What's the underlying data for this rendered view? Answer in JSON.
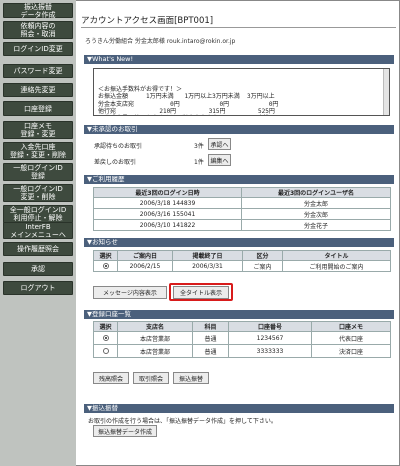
{
  "sidebar": {
    "items": [
      {
        "lines": [
          "振込振替",
          "データ作成"
        ]
      },
      {
        "lines": [
          "依頼内容の",
          "照会・取消"
        ]
      },
      {
        "lines": [
          "ログインID変更"
        ]
      },
      {
        "lines": [
          "パスワード変更"
        ]
      },
      {
        "lines": [
          "連絡先変更"
        ]
      },
      {
        "lines": [
          "口座登録"
        ]
      },
      {
        "lines": [
          "口座メモ",
          "登録・変更"
        ]
      },
      {
        "lines": [
          "入金先口座",
          "登録・変更・削除"
        ]
      },
      {
        "lines": [
          "一般ログインID",
          "登録"
        ]
      },
      {
        "lines": [
          "一般ログインID",
          "変更・削除"
        ]
      },
      {
        "lines": [
          "全一般ログインID",
          "利用停止・解除"
        ]
      },
      {
        "lines": [
          "InterFB",
          "メインメニューへ"
        ]
      },
      {
        "lines": [
          "操作履歴照会"
        ]
      },
      {
        "lines": [
          "承認"
        ]
      },
      {
        "lines": [
          "ログアウト"
        ]
      }
    ]
  },
  "header": {
    "title": "アカウントアクセス画面[BPT001]",
    "user_line": "ろうきん労働組合  労金太郎様  rouk.intaro@rokin.or.jp"
  },
  "whats_new": {
    "heading": "▼What's New!",
    "text": "＜お振込手数料がお得です！＞\nお振込金額     1万円未満   1万円以上3万円未満  3万円以上\n労金本支店宛          0円           0円           0円\n他行宛            210円         315円         525円\n※当式会員以外のお客さまは、労金本支店宛について3万円未満\n105円、3万円以上 210円です。"
  },
  "unapproved": {
    "heading": "▼未承認のお取引",
    "rows": [
      {
        "label": "承認待ちのお取引",
        "count": "3件",
        "button": "承認へ"
      },
      {
        "label": "差戻しのお取引",
        "count": "1件",
        "button": "編集へ"
      }
    ]
  },
  "history": {
    "heading": "▼ご利用履歴",
    "columns": [
      "最近3回のログイン日時",
      "最近3回のログインユーザ名"
    ],
    "rows": [
      [
        "2006/3/18  144839",
        "労金太郎"
      ],
      [
        "2006/3/16  155041",
        "労金次郎"
      ],
      [
        "2006/3/10  141822",
        "労金花子"
      ]
    ]
  },
  "notices": {
    "heading": "▼お知らせ",
    "columns": [
      "選択",
      "ご案内日",
      "掲載終了日",
      "区分",
      "タイトル"
    ],
    "rows": [
      [
        "",
        "2006/2/15",
        "2006/3/31",
        "ご案内",
        "ご利用開始のご案内"
      ]
    ],
    "buttons": {
      "show_message": "メッセージ内容表示",
      "show_titles": "全タイトル表示"
    }
  },
  "accounts": {
    "heading": "▼登録口座一覧",
    "columns": [
      "選択",
      "支店名",
      "科目",
      "口座番号",
      "口座メモ"
    ],
    "rows": [
      [
        "",
        "本店営業部",
        "普通",
        "1234567",
        "代表口座"
      ],
      [
        "",
        "本店営業部",
        "普通",
        "3333333",
        "決済口座"
      ]
    ],
    "buttons": {
      "balance": "残高照会",
      "transactions": "取引照会",
      "transfer": "振込振替"
    }
  },
  "transfer": {
    "heading": "▼振込振替",
    "text": "お取引の作成を行う場合は、「振込振替データ作成」を押して下さい。",
    "button": "振込振替データ作成"
  }
}
